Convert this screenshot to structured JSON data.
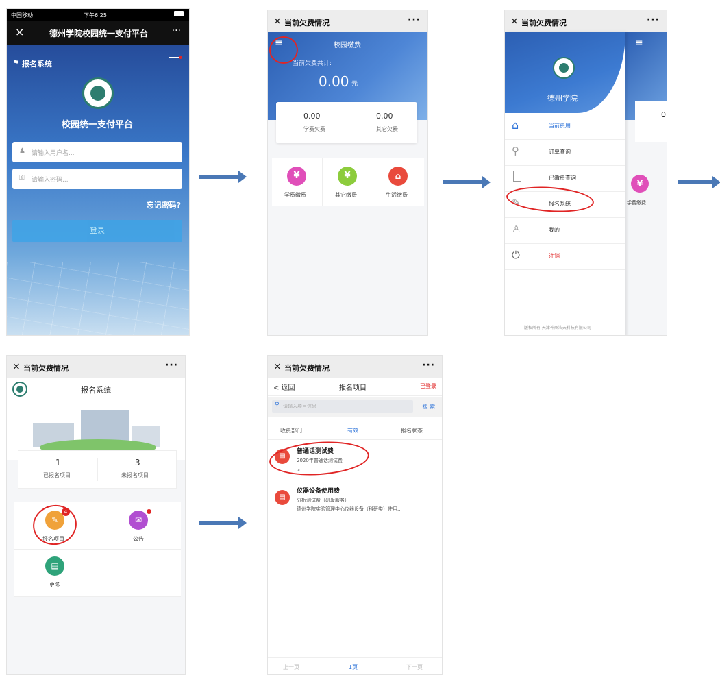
{
  "login": {
    "status_carrier": "中国移动",
    "status_time": "下午6:25",
    "title": "德州学院校园统一支付平台",
    "close": "×",
    "more": "···",
    "signup_link": "报名系统",
    "logo_title": "校园统一支付平台",
    "username_placeholder": "请输入用户名...",
    "password_placeholder": "请输入密码...",
    "forgot": "忘记密码?",
    "login_button": "登录"
  },
  "fees": {
    "wx_title": "当前欠费情况",
    "header_title": "校园缴费",
    "total_label": "当前欠费共计:",
    "total_amount": "0.00",
    "total_unit": "元",
    "tuition_value": "0.00",
    "tuition_label": "学费欠费",
    "other_value": "0.00",
    "other_label": "其它欠费",
    "grid": [
      "学费缴费",
      "其它缴费",
      "生活缴费"
    ]
  },
  "menu": {
    "wx_title": "当前欠费情况",
    "school": "德州学院",
    "items": [
      "当前费用",
      "订单查询",
      "已缴费查询",
      "报名系统",
      "我的",
      "注销"
    ],
    "footer": "版权所有 天津神州浩天科技有限公司",
    "peek_value": "0",
    "peek_label": "学费缴费"
  },
  "signup": {
    "wx_title": "当前欠费情况",
    "title": "报名系统",
    "signed_count": "1",
    "signed_label": "已报名项目",
    "unsigned_count": "3",
    "unsigned_label": "未报名项目",
    "tiles": [
      "报名项目",
      "公告",
      "更多"
    ],
    "badge": "4"
  },
  "projects": {
    "wx_title": "当前欠费情况",
    "back": "< 返回",
    "title": "报名项目",
    "login_state": "已登录",
    "search_placeholder": "请输入项目信息",
    "search_button": "搜 索",
    "filters": [
      "收费部门",
      "有效",
      "报名状态"
    ],
    "items": [
      {
        "title": "普通话测试费",
        "line1": "2020年普通话测试费",
        "line2": "无"
      },
      {
        "title": "仪器设备使用费",
        "line1": "分析测试费（研发服务）",
        "line2": "德州学院实验管理中心仪器设备（科研类）使用..."
      }
    ],
    "pager": [
      "上一页",
      "1页",
      "下一页"
    ]
  },
  "colors": {
    "arrow": "#4a78b6",
    "annotation": "#e02525",
    "accent": "#2f74d9",
    "header": "#3b6fc7"
  }
}
